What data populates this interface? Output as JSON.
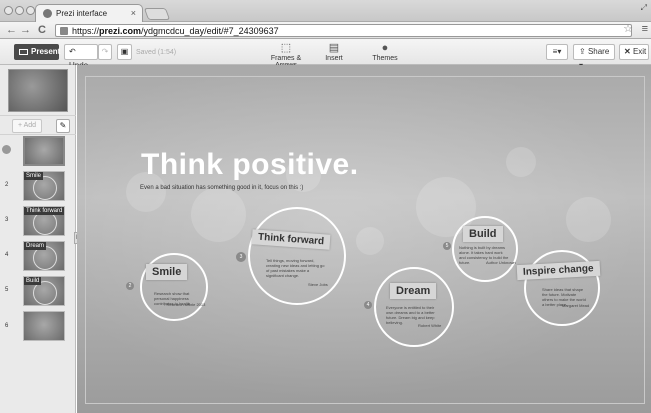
{
  "browser": {
    "tab_title": "Prezi interface",
    "tab_close": "×",
    "url_scheme": "https://",
    "url_host": "prezi.com",
    "url_path": "/ydgmcdcu_day/edit/#7_24309637"
  },
  "toolbar": {
    "present_label": "Present",
    "undo_label": "Undo",
    "saved_label": "Saved (1:54)",
    "tools": [
      {
        "label": "Frames & Arrows",
        "icon": "frames-arrows-icon"
      },
      {
        "label": "Insert",
        "icon": "insert-icon"
      },
      {
        "label": "Themes",
        "icon": "themes-icon"
      }
    ],
    "share_label": "Share",
    "exit_label": "Exit"
  },
  "sidebar": {
    "add_label": "+ Add",
    "thumbnails": [
      {
        "num": "",
        "label": ""
      },
      {
        "num": "2",
        "label": "Smile"
      },
      {
        "num": "3",
        "label": "Think forward"
      },
      {
        "num": "4",
        "label": "Dream"
      },
      {
        "num": "5",
        "label": "Build"
      },
      {
        "num": "6",
        "label": ""
      }
    ]
  },
  "canvas": {
    "title": "Think positive.",
    "subtitle": "Even a bad situation has something good in it, focus on this :)",
    "nodes": [
      {
        "id": "smile",
        "title": "Smile",
        "num": "2",
        "text": "Research show that personal happiness contributes to health...",
        "author": "- Research article 2013"
      },
      {
        "id": "think",
        "title": "Think forward",
        "num": "3",
        "text": "Tell things, moving forward, creating new ideas and letting go of past mistakes make a significant change.",
        "author": "Steve Jobs"
      },
      {
        "id": "dream",
        "title": "Dream",
        "num": "4",
        "text": "Everyone is entitled to their own dreams and to a better future. Dream big and keep believing.",
        "author": "Robert White"
      },
      {
        "id": "build",
        "title": "Build",
        "num": "5",
        "text": "Nothing is built by dreams alone. It takes hard work and consistency to build the future.",
        "author": "Author Unknown"
      },
      {
        "id": "inspire",
        "title": "Inspire change",
        "num": "6",
        "text": "Share ideas that shape the future. Motivate others to make the world a better place.",
        "author": "Margaret Mead"
      }
    ]
  }
}
